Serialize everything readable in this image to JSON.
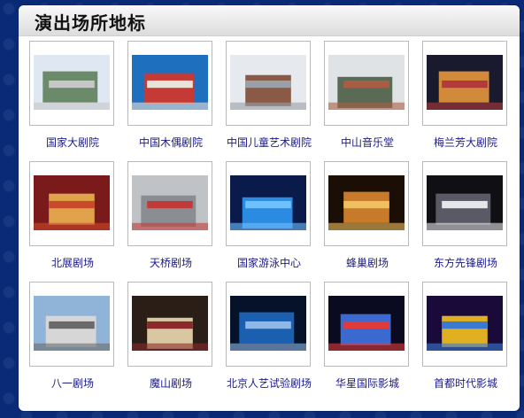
{
  "panel": {
    "title": "演出场所地标"
  },
  "venues": [
    {
      "name": "国家大剧院",
      "palette": [
        "#dfe8f2",
        "#6a8a6a",
        "#c7c7c7"
      ]
    },
    {
      "name": "中国木偶剧院",
      "palette": [
        "#1f6fbf",
        "#c63a36",
        "#e8e4d9"
      ]
    },
    {
      "name": "中国儿童艺术剧院",
      "palette": [
        "#e6e9ee",
        "#8a5a46",
        "#9aa0a6"
      ]
    },
    {
      "name": "中山音乐堂",
      "palette": [
        "#dfe3e6",
        "#5a6b55",
        "#a85d45"
      ]
    },
    {
      "name": "梅兰芳大剧院",
      "palette": [
        "#1a1a2e",
        "#d18a3a",
        "#b23a3a"
      ]
    },
    {
      "name": "北展剧场",
      "palette": [
        "#7a1a1a",
        "#e0a24a",
        "#c94a2a"
      ]
    },
    {
      "name": "天桥剧场",
      "palette": [
        "#bfc3c6",
        "#8a8e92",
        "#c23b3b"
      ]
    },
    {
      "name": "国家游泳中心",
      "palette": [
        "#0a1a4a",
        "#2a8be0",
        "#6fc0ff"
      ]
    },
    {
      "name": "蜂巢剧场",
      "palette": [
        "#1a0e05",
        "#c77a2a",
        "#f0c060"
      ]
    },
    {
      "name": "东方先锋剧场",
      "palette": [
        "#0f0f14",
        "#5a5a66",
        "#e6e6ea"
      ]
    },
    {
      "name": "八一剧场",
      "palette": [
        "#8fb4d8",
        "#d6d6d6",
        "#6a6a6a"
      ]
    },
    {
      "name": "魔山剧场",
      "palette": [
        "#2a1e16",
        "#d8c7a0",
        "#8a2a2a"
      ]
    },
    {
      "name": "北京人艺试验剧场",
      "palette": [
        "#05122a",
        "#1a5fb0",
        "#8fb8e8"
      ]
    },
    {
      "name": "华星国际影城",
      "palette": [
        "#0a0a20",
        "#3a6ad0",
        "#e03a3a"
      ]
    },
    {
      "name": "首都时代影城",
      "palette": [
        "#1a0a3a",
        "#e0b020",
        "#3a7ad0"
      ]
    }
  ]
}
